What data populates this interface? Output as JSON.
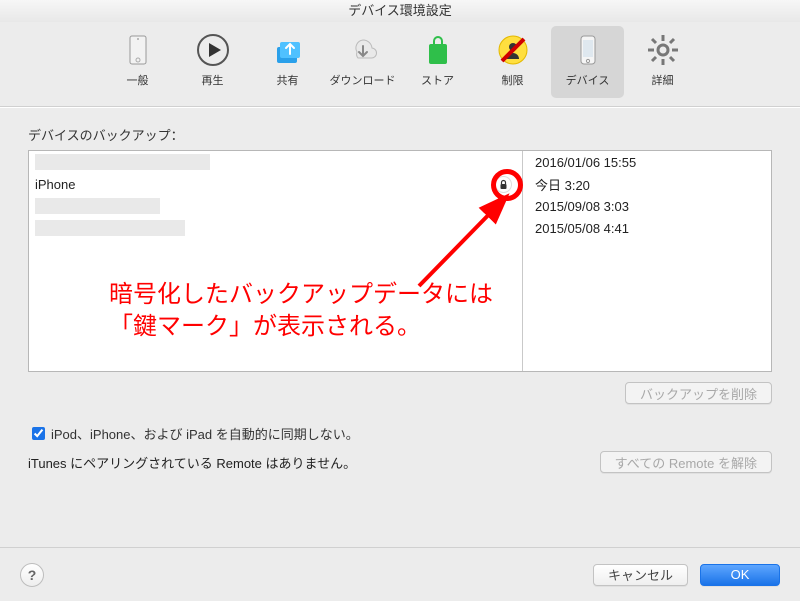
{
  "window": {
    "title": "デバイス環境設定"
  },
  "toolbar": {
    "items": [
      {
        "label": "一般",
        "icon": "general-icon",
        "selected": false
      },
      {
        "label": "再生",
        "icon": "play-icon",
        "selected": false
      },
      {
        "label": "共有",
        "icon": "share-icon",
        "selected": false
      },
      {
        "label": "ダウンロード",
        "icon": "download-icon",
        "selected": false
      },
      {
        "label": "ストア",
        "icon": "store-icon",
        "selected": false
      },
      {
        "label": "制限",
        "icon": "restrict-icon",
        "selected": false
      },
      {
        "label": "デバイス",
        "icon": "device-icon",
        "selected": true
      },
      {
        "label": "詳細",
        "icon": "advanced-icon",
        "selected": false
      }
    ]
  },
  "backups": {
    "heading": "デバイスのバックアップ：",
    "rows": [
      {
        "name_redacted": true,
        "name": "",
        "encrypted": false,
        "date": "2016/01/06 15:55"
      },
      {
        "name_redacted": false,
        "name": "iPhone",
        "encrypted": true,
        "date": "今日 3:20"
      },
      {
        "name_redacted": true,
        "name": "",
        "encrypted": false,
        "date": "2015/09/08 3:03"
      },
      {
        "name_redacted": true,
        "name": "",
        "encrypted": false,
        "date": "2015/05/08 4:41"
      }
    ],
    "delete_button": "バックアップを削除"
  },
  "annotation": {
    "line1": "暗号化したバックアップデータには",
    "line2": "「鍵マーク」が表示される。"
  },
  "sync": {
    "checkbox_label": "iPod、iPhone、および iPad を自動的に同期しない。",
    "checkbox_checked": true,
    "remote_text": "iTunes にペアリングされている Remote はありません。",
    "remote_button": "すべての Remote を解除"
  },
  "footer": {
    "help_glyph": "?",
    "cancel": "キャンセル",
    "ok": "OK"
  },
  "colors": {
    "accent": "#1a73e8",
    "annotation_red": "#ff0000"
  }
}
